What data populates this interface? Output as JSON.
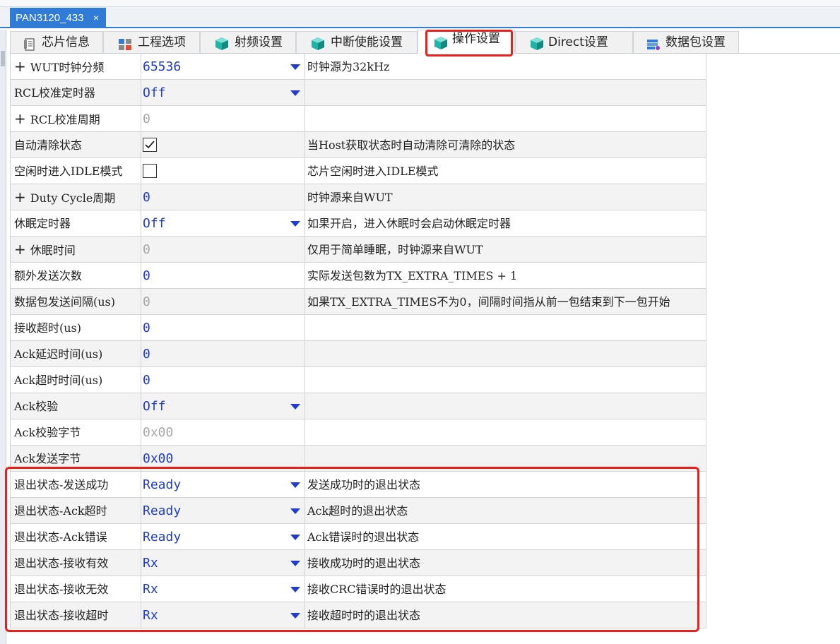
{
  "document_tab": {
    "title": "PAN3120_433",
    "close_label": "×"
  },
  "tabs": [
    {
      "label": "芯片信息",
      "icon": "chip-info-icon"
    },
    {
      "label": "工程选项",
      "icon": "project-options-icon"
    },
    {
      "label": "射频设置",
      "icon": "cube-icon"
    },
    {
      "label": "中断使能设置",
      "icon": "cube-icon"
    },
    {
      "label": "操作设置",
      "icon": "cube-icon",
      "active": true
    },
    {
      "label": "Direct设置",
      "icon": "cube-icon"
    },
    {
      "label": "数据包设置",
      "icon": "packet-icon"
    }
  ],
  "properties": [
    {
      "name": "WUT时钟分频",
      "expandable": true,
      "value": "65536",
      "type": "dropdown",
      "description": "时钟源为32kHz"
    },
    {
      "name": "RCL校准定时器",
      "value": "Off",
      "type": "dropdown",
      "description": ""
    },
    {
      "name": "RCL校准周期",
      "expandable": true,
      "value": "0",
      "disabled": true,
      "description": ""
    },
    {
      "name": "自动清除状态",
      "type": "checkbox",
      "checked": true,
      "description": "当Host获取状态时自动清除可清除的状态"
    },
    {
      "name": "空闲时进入IDLE模式",
      "type": "checkbox",
      "checked": false,
      "description": "芯片空闲时进入IDLE模式"
    },
    {
      "name": "Duty Cycle周期",
      "expandable": true,
      "value": "0",
      "description": "时钟源来自WUT"
    },
    {
      "name": "休眠定时器",
      "value": "Off",
      "type": "dropdown",
      "description": "如果开启，进入休眠时会启动休眠定时器"
    },
    {
      "name": "休眠时间",
      "expandable": true,
      "value": "0",
      "disabled": true,
      "description": "仅用于简单睡眠，时钟源来自WUT"
    },
    {
      "name": "额外发送次数",
      "value": "0",
      "description": "实际发送包数为TX_EXTRA_TIMES + 1"
    },
    {
      "name": "数据包发送间隔(us)",
      "value": "0",
      "disabled": true,
      "description": "如果TX_EXTRA_TIMES不为0，间隔时间指从前一包结束到下一包开始"
    },
    {
      "name": "接收超时(us)",
      "value": "0",
      "description": ""
    },
    {
      "name": "Ack延迟时间(us)",
      "value": "0",
      "description": ""
    },
    {
      "name": "Ack超时时间(us)",
      "value": "0",
      "description": ""
    },
    {
      "name": "Ack校验",
      "value": "Off",
      "type": "dropdown",
      "description": ""
    },
    {
      "name": "Ack校验字节",
      "value": "0x00",
      "disabled": true,
      "description": ""
    },
    {
      "name": "Ack发送字节",
      "value": "0x00",
      "description": ""
    },
    {
      "name": "退出状态-发送成功",
      "value": "Ready",
      "type": "dropdown",
      "description": "发送成功时的退出状态"
    },
    {
      "name": "退出状态-Ack超时",
      "value": "Ready",
      "type": "dropdown",
      "description": "Ack超时的退出状态"
    },
    {
      "name": "退出状态-Ack错误",
      "value": "Ready",
      "type": "dropdown",
      "description": "Ack错误时的退出状态"
    },
    {
      "name": "退出状态-接收有效",
      "value": "Rx",
      "type": "dropdown",
      "description": "接收成功时的退出状态"
    },
    {
      "name": "退出状态-接收无效",
      "value": "Rx",
      "type": "dropdown",
      "description": "接收CRC错误时的退出状态"
    },
    {
      "name": "退出状态-接收超时",
      "value": "Rx",
      "type": "dropdown",
      "description": "接收超时时的退出状态"
    }
  ],
  "colors": {
    "accent": "#2f7bd6",
    "value_text": "#1f3bd4",
    "highlight": "#e8201c",
    "cube": "#1fb5a6"
  }
}
